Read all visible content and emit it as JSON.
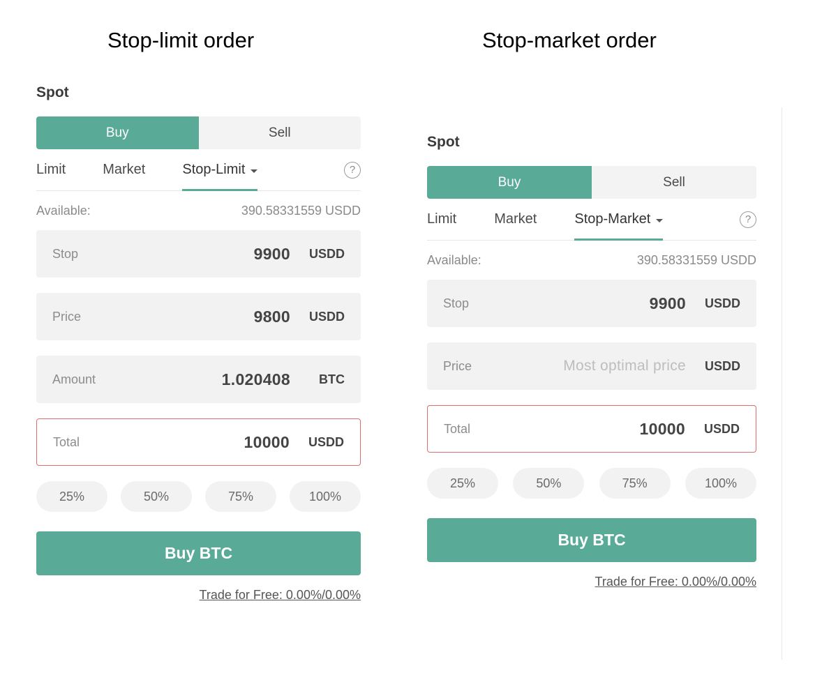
{
  "captions": {
    "left": "Stop-limit order",
    "right": "Stop-market order"
  },
  "colors": {
    "accent": "#5aaa98",
    "error_border": "#e26b6b",
    "field_bg": "#f2f2f2"
  },
  "left_panel": {
    "title": "Spot",
    "buy_label": "Buy",
    "sell_label": "Sell",
    "tabs": [
      "Limit",
      "Market",
      "Stop-Limit"
    ],
    "active_tab": "Stop-Limit",
    "help_icon": "?",
    "available_label": "Available:",
    "available_value": "390.58331559 USDD",
    "fields": {
      "stop": {
        "label": "Stop",
        "value": "9900",
        "unit": "USDD"
      },
      "price": {
        "label": "Price",
        "value": "9800",
        "unit": "USDD"
      },
      "amount": {
        "label": "Amount",
        "value": "1.020408",
        "unit": "BTC"
      },
      "total": {
        "label": "Total",
        "value": "10000",
        "unit": "USDD"
      }
    },
    "percent_buttons": [
      "25%",
      "50%",
      "75%",
      "100%"
    ],
    "submit_label": "Buy BTC",
    "fee_text": "Trade for Free: 0.00%/0.00%"
  },
  "right_panel": {
    "title": "Spot",
    "buy_label": "Buy",
    "sell_label": "Sell",
    "tabs": [
      "Limit",
      "Market",
      "Stop-Market"
    ],
    "active_tab": "Stop-Market",
    "help_icon": "?",
    "available_label": "Available:",
    "available_value": "390.58331559 USDD",
    "fields": {
      "stop": {
        "label": "Stop",
        "value": "9900",
        "unit": "USDD"
      },
      "price": {
        "label": "Price",
        "placeholder": "Most optimal price",
        "unit": "USDD"
      },
      "total": {
        "label": "Total",
        "value": "10000",
        "unit": "USDD"
      }
    },
    "percent_buttons": [
      "25%",
      "50%",
      "75%",
      "100%"
    ],
    "submit_label": "Buy BTC",
    "fee_text": "Trade for Free: 0.00%/0.00%"
  }
}
